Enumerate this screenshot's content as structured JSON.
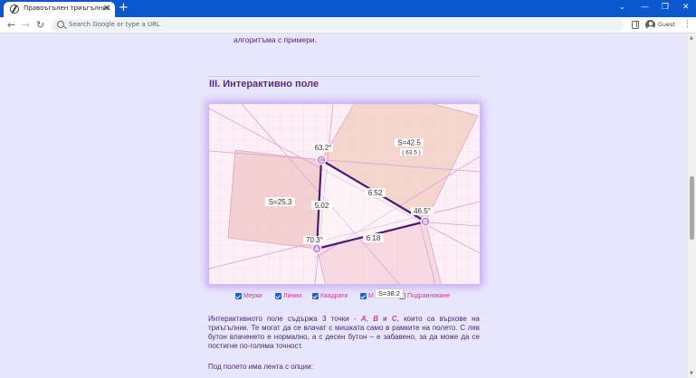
{
  "browser": {
    "tab_title": "Правоъгълен триъгълник",
    "tab_close": "✕",
    "new_tab": "+",
    "tab_search": "⌄",
    "window_min": "—",
    "window_max": "❐",
    "window_close": "✕",
    "back": "←",
    "forward": "→",
    "reload": "↻",
    "omnibox_placeholder": "Search Google or type a URL",
    "profile_label": "Guest",
    "menu": "⋮",
    "scroll_up": "▲",
    "scroll_down": "▼"
  },
  "page": {
    "intro_tail": "алгоритъма с примери.",
    "section_title": "III. Интерактивно поле",
    "field": {
      "area_c": "S=42.5",
      "area_c_sub": "( 63.5 )",
      "area_b": "S=25.3",
      "side_a": "6.52",
      "side_b": "5.02",
      "side_c": "6.18",
      "angle_a": "70.3°",
      "angle_b": "46.5°",
      "angle_c": "63.2°",
      "point_a": "A",
      "point_b": "B",
      "point_c": "C"
    },
    "options": [
      {
        "label": "Мерки",
        "checked": true
      },
      {
        "label": "Линии",
        "checked": true
      },
      {
        "label": "Квадрати",
        "checked": true
      },
      {
        "label": "М",
        "checked": true
      },
      {
        "label": "Подравняване",
        "checked": false
      }
    ],
    "area_tooltip": "S=38.2",
    "para1": {
      "start": "Интерактивното поле съдържа 3 точки - ",
      "a": "A",
      "sep1": ", ",
      "b": "B",
      "and": " и ",
      "c": "C",
      "rest": ", които са върхове на триъгълник. Те могат да се влачат с мишката само в рамките на полето. С ляв бутон влаченето е нормално, а с десен бутон – е забавено, за да може да се постигне по-голяма точност."
    },
    "para2": "Под полето има лента с опции:"
  },
  "colors": {
    "chrome_blue": "#0b57d0",
    "page_bg": "#e8e6fd",
    "field_bg": "#fceff5",
    "triangle": "#4a1a7a",
    "accent_pink": "#d03a8c"
  }
}
